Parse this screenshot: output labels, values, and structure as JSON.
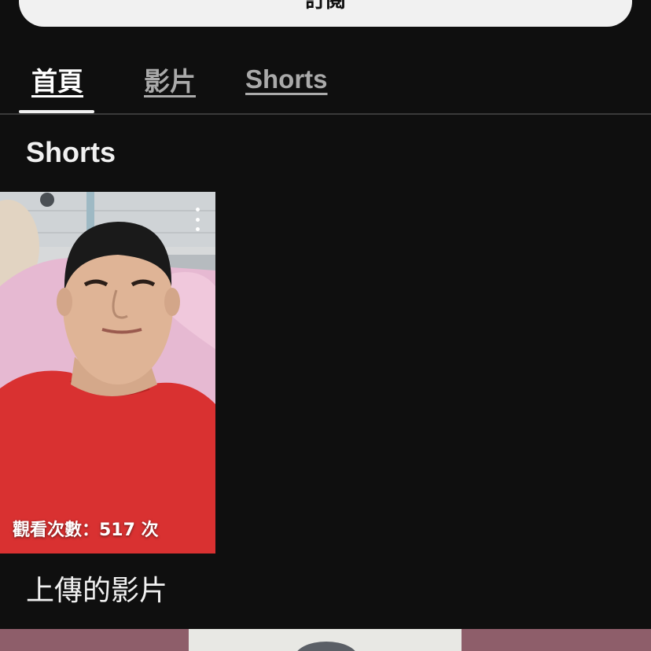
{
  "header": {
    "subscribe_label": "訂閱"
  },
  "tabs": [
    {
      "label": "首頁",
      "selected": true
    },
    {
      "label": "影片",
      "selected": false
    },
    {
      "label": "Shorts",
      "selected": false
    }
  ],
  "sections": {
    "shorts_title": "Shorts",
    "uploads_title": "上傳的影片"
  },
  "shorts": [
    {
      "views": "觀看次數：517 次",
      "thumbnail": "selfie-red-shirt-hospital-bed"
    }
  ],
  "icons": {
    "more": "more-vert-icon"
  },
  "colors": {
    "background": "#0f0f0f",
    "text_primary": "#f1f1f1",
    "tab_inactive": "#aaaaaa",
    "divider": "#3a3a3a"
  }
}
